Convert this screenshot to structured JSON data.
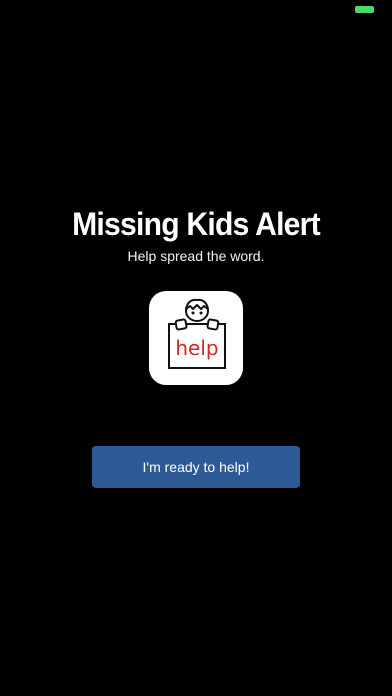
{
  "status_bar": {
    "battery_color": "#4cd964"
  },
  "main": {
    "title": "Missing Kids Alert",
    "subtitle": "Help spread the word.",
    "app_icon": {
      "icon": "child-holding-help-sign-icon",
      "sign_text": "help",
      "sign_text_color": "#cc2b22"
    },
    "cta_label": "I'm ready to help!",
    "cta_color": "#2d5a95"
  }
}
